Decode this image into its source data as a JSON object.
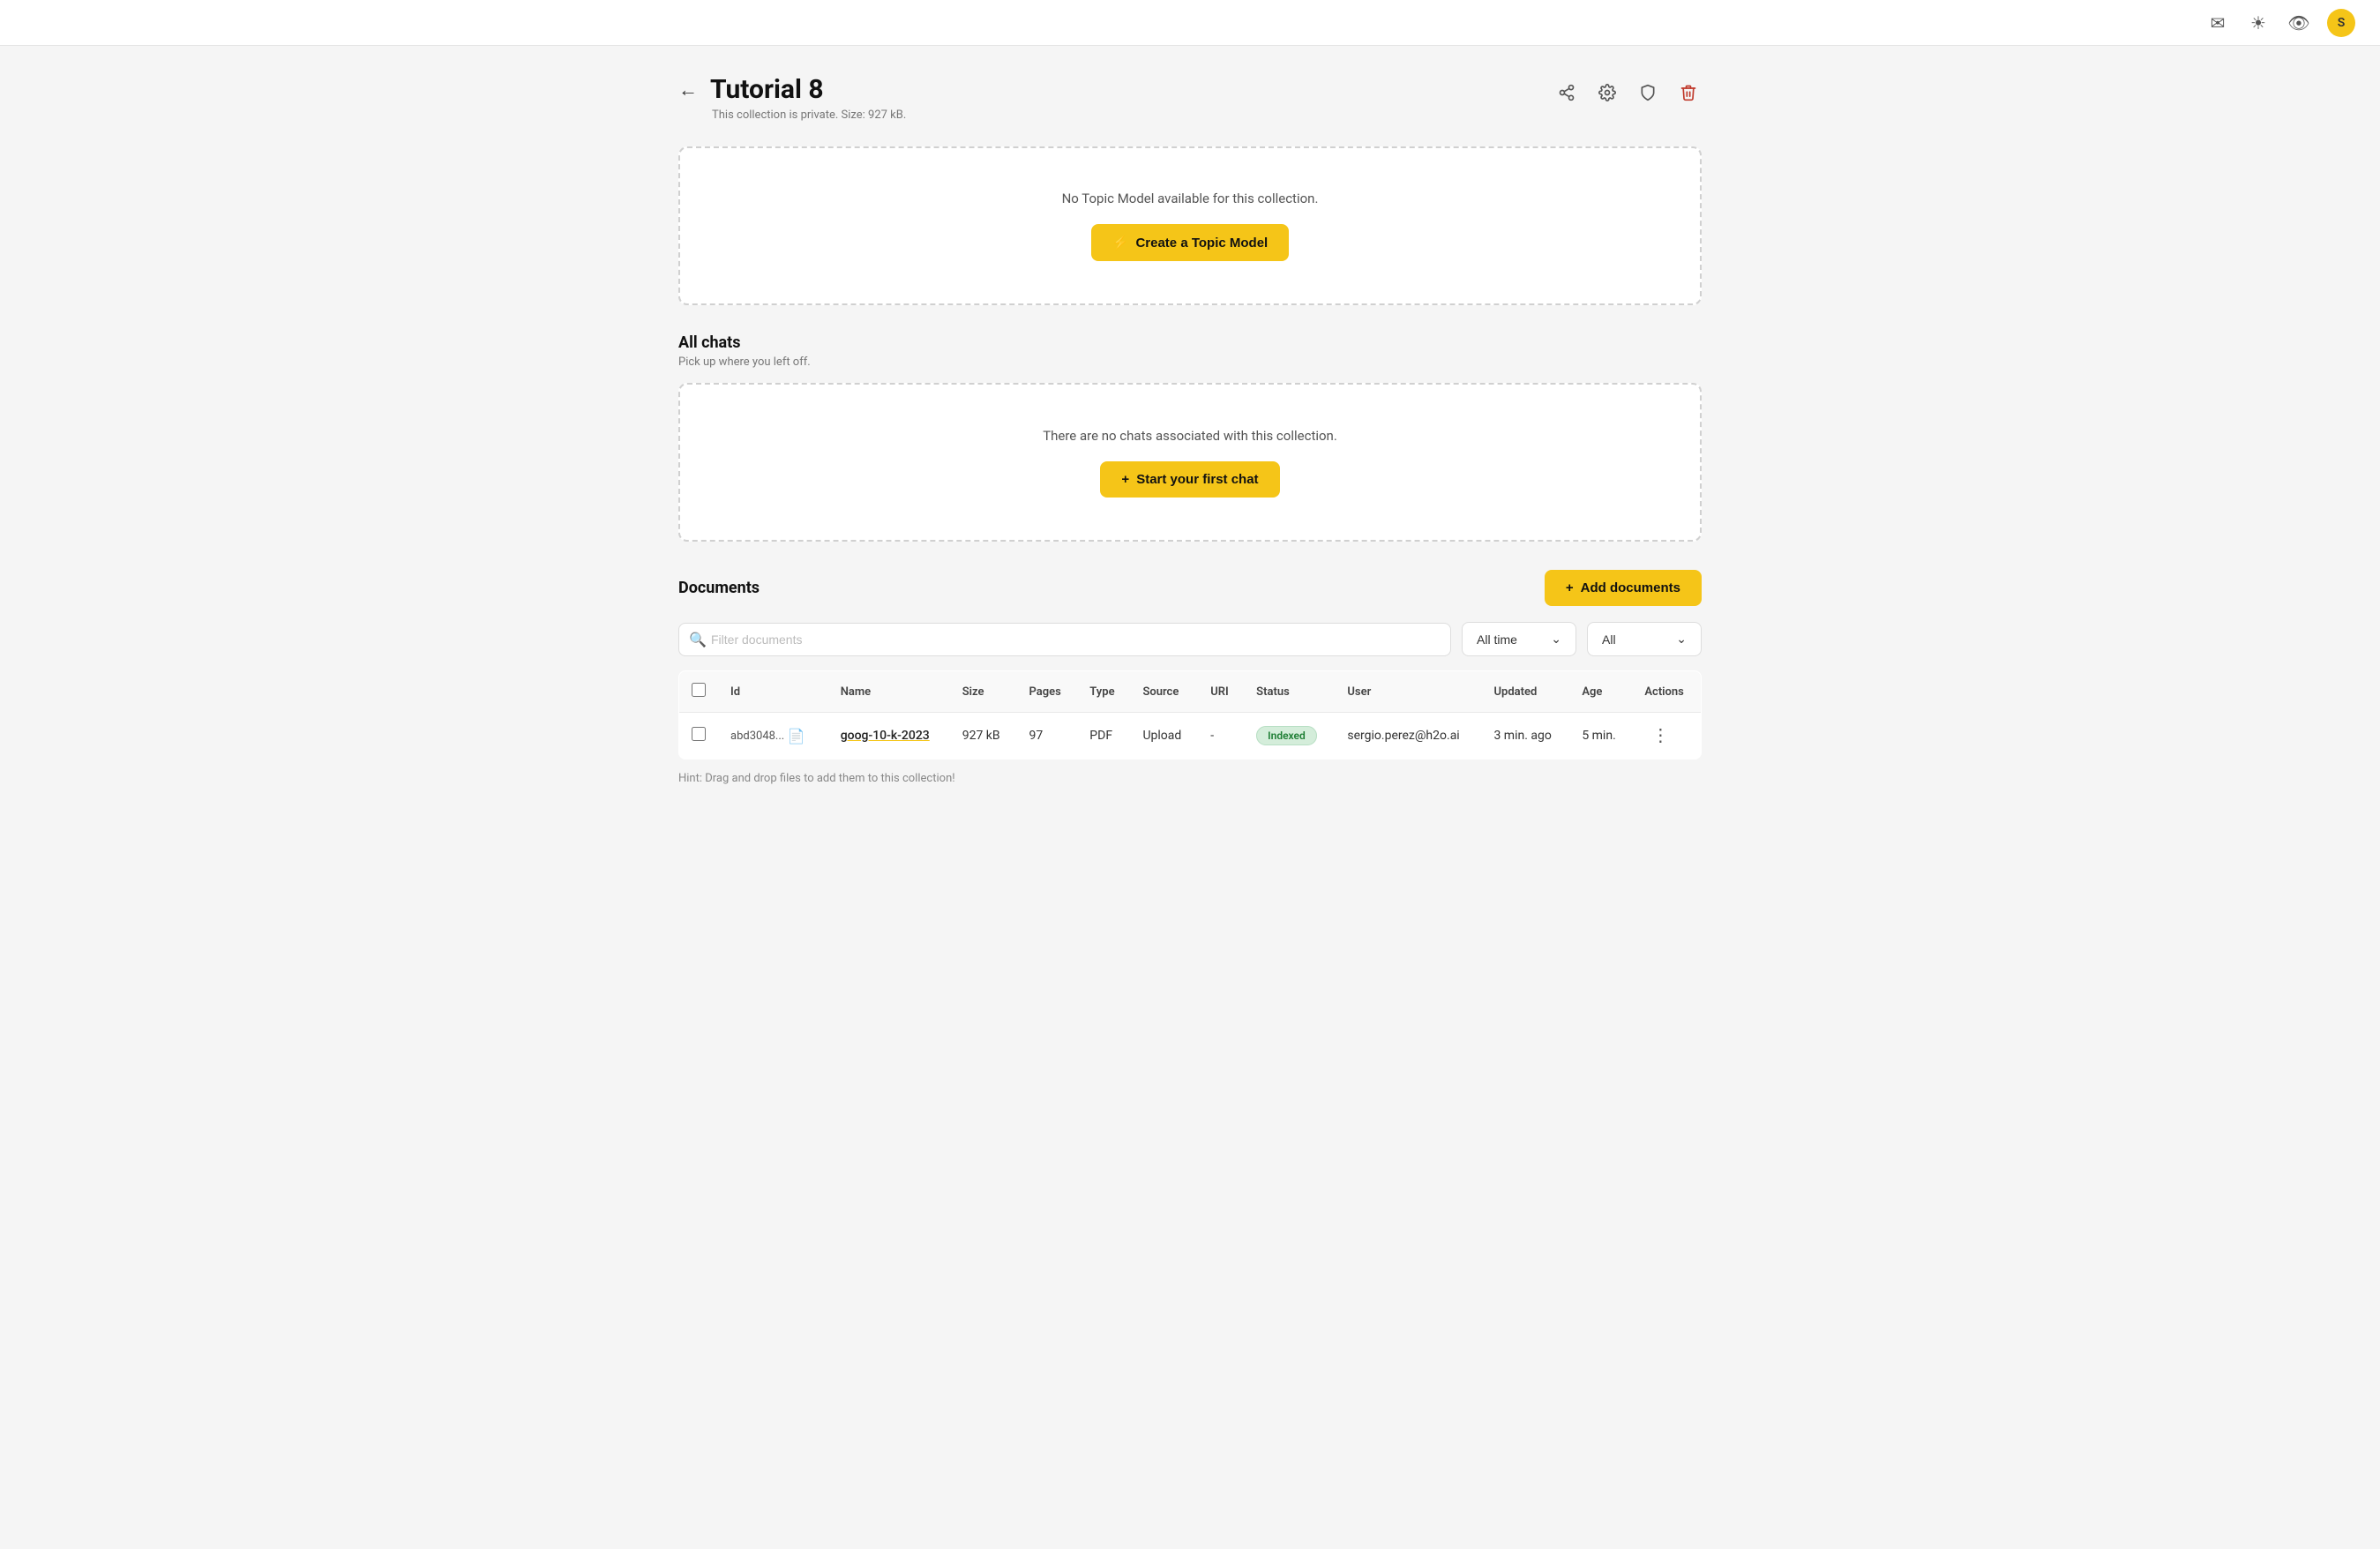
{
  "topbar": {
    "icons": [
      "inbox-icon",
      "sun-icon",
      "eye-icon"
    ],
    "avatar_label": "S"
  },
  "header": {
    "back_label": "←",
    "title": "Tutorial 8",
    "subtitle": "This collection is private. Size: 927 kB.",
    "actions": [
      "share-icon",
      "settings-icon",
      "shield-icon",
      "trash-icon"
    ]
  },
  "topic_model_box": {
    "empty_text": "No Topic Model available for this collection.",
    "create_btn_label": "Create a Topic Model",
    "create_btn_icon": "⚡"
  },
  "chats_section": {
    "heading": "All chats",
    "subheading": "Pick up where you left off.",
    "empty_text": "There are no chats associated with this collection.",
    "start_btn_label": "Start your first chat",
    "start_btn_icon": "+"
  },
  "documents_section": {
    "heading": "Documents",
    "add_btn_label": "Add documents",
    "add_btn_icon": "+",
    "filter_placeholder": "Filter documents",
    "time_filter_label": "All time",
    "type_filter_label": "All",
    "table_columns": [
      "Id",
      "Name",
      "Size",
      "Pages",
      "Type",
      "Source",
      "URI",
      "Status",
      "User",
      "Updated",
      "Age",
      "Actions"
    ],
    "documents": [
      {
        "id": "abd3048...",
        "name": "goog-10-k-2023",
        "size": "927 kB",
        "pages": "97",
        "type": "PDF",
        "source": "Upload",
        "uri": "-",
        "status": "Indexed",
        "user": "sergio.perez@h2o.ai",
        "updated": "3 min. ago",
        "age": "5 min."
      }
    ],
    "hint": "Hint: Drag and drop files to add them to this collection!"
  }
}
